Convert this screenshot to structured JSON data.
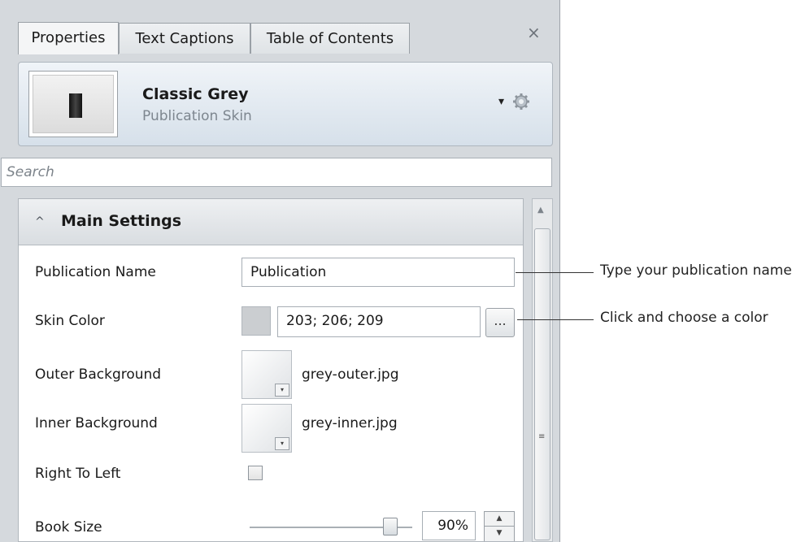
{
  "tabs": [
    "Properties",
    "Text Captions",
    "Table of Contents"
  ],
  "close_glyph": "×",
  "skin": {
    "title": "Classic Grey",
    "subtitle": "Publication Skin",
    "menu_glyph": "▾",
    "gear_icon": "gear-icon"
  },
  "search": {
    "placeholder": "Search"
  },
  "section": {
    "title": "Main Settings",
    "chevron_glyph": "^"
  },
  "rows": {
    "publication_name": {
      "label": "Publication Name",
      "value": "Publication"
    },
    "skin_color": {
      "label": "Skin Color",
      "value": "203; 206; 209",
      "swatch": "#cbced1",
      "button": "..."
    },
    "outer_background": {
      "label": "Outer Background",
      "file": "grey-outer.jpg"
    },
    "inner_background": {
      "label": "Inner Background",
      "file": "grey-inner.jpg"
    },
    "right_to_left": {
      "label": "Right To Left",
      "checked": false
    },
    "book_size": {
      "label": "Book Size",
      "value": "90%"
    }
  },
  "callouts": [
    "Type your publication name",
    "Click and choose a color"
  ],
  "scrollbar": {
    "grip_glyph": "≡"
  }
}
